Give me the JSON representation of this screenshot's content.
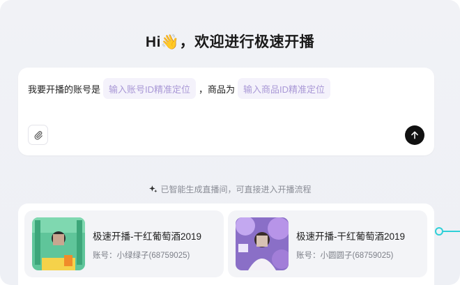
{
  "header": {
    "title": "Hi👋，欢迎进行极速开播"
  },
  "composer": {
    "prefix": "我要开播的账号是",
    "account_placeholder": "输入账号ID精准定位",
    "separator": "，商品为",
    "product_placeholder": "输入商品ID精准定位",
    "attach_icon": "paperclip-icon",
    "send_icon": "arrow-up-icon"
  },
  "hint": {
    "text": "已智能生成直播间，可直接进入开播流程",
    "icon": "sparkle-icon"
  },
  "cards": [
    {
      "title": "极速开播-干红葡萄酒2019",
      "account": "账号：小绿绿子(68759025)"
    },
    {
      "title": "极速开播-干红葡萄酒2019",
      "account": "账号：小圆圆子(68759025)"
    }
  ],
  "colors": {
    "chip_text": "#a998d6",
    "chip_bg": "#f4f2fb",
    "connector": "#2fd0d8",
    "send_bg": "#111111"
  }
}
